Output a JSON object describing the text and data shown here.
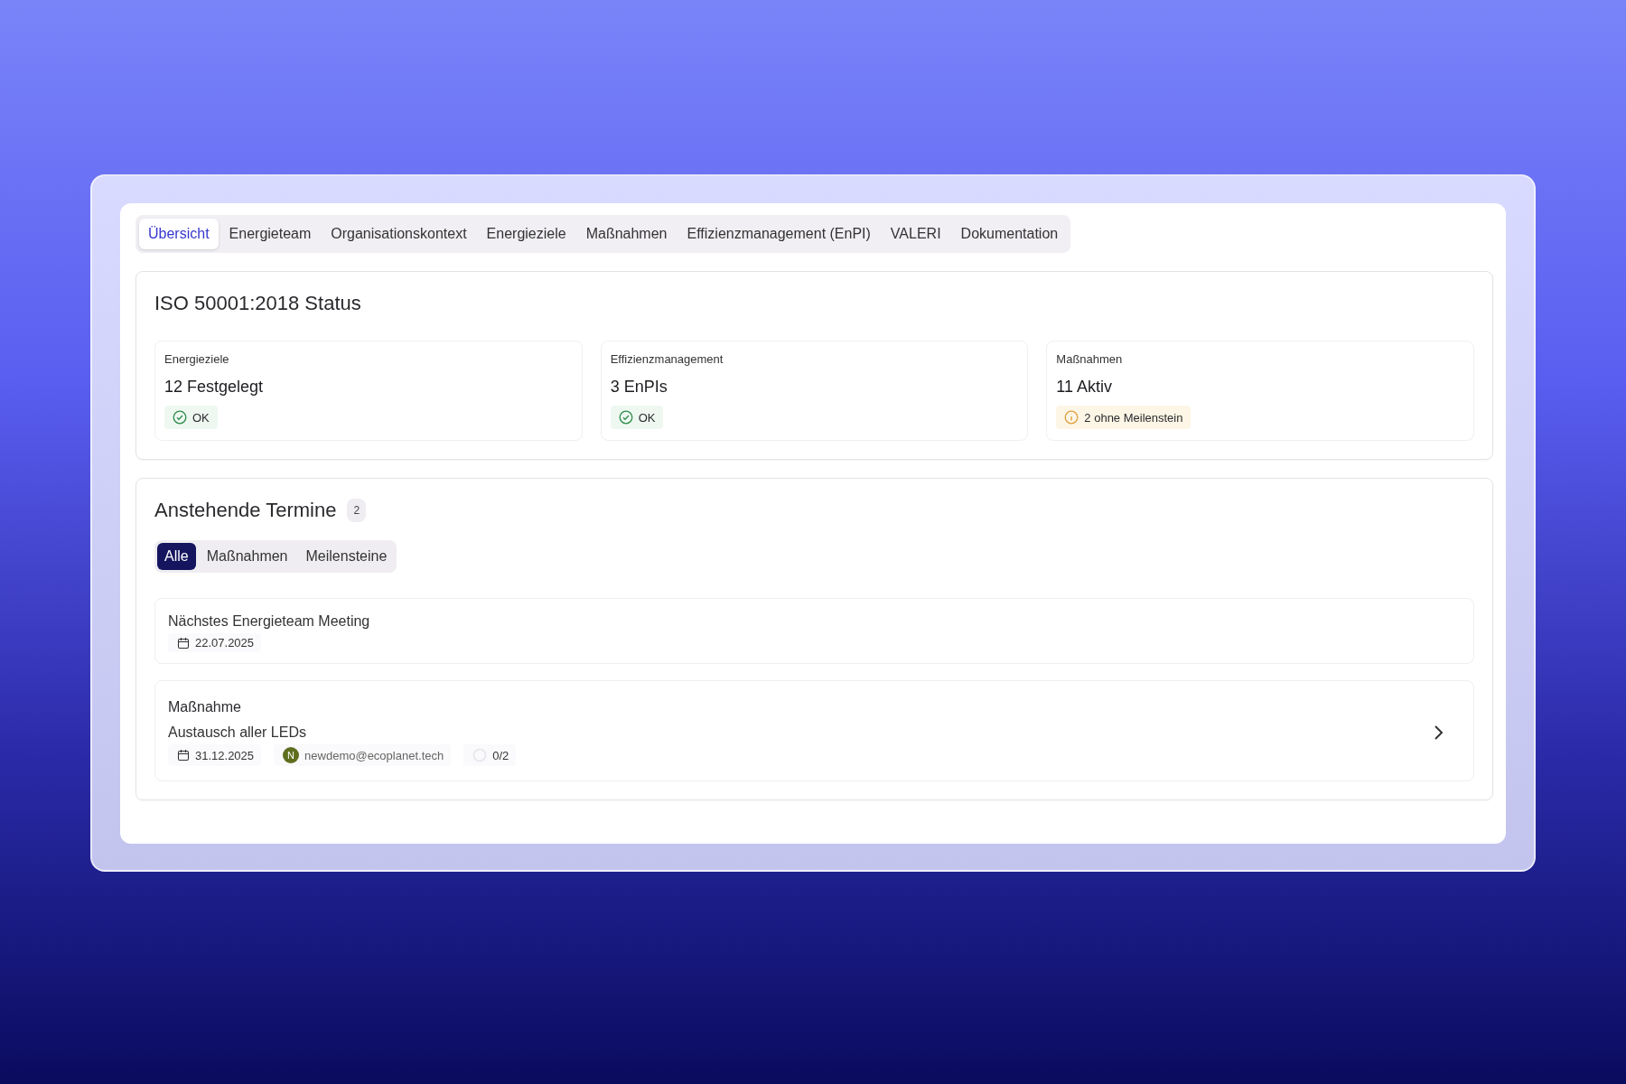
{
  "tabs": [
    {
      "label": "Übersicht",
      "selected": true
    },
    {
      "label": "Energieteam",
      "selected": false
    },
    {
      "label": "Organisationskontext",
      "selected": false
    },
    {
      "label": "Energieziele",
      "selected": false
    },
    {
      "label": "Maßnahmen",
      "selected": false
    },
    {
      "label": "Effizienzmanagement (EnPI)",
      "selected": false
    },
    {
      "label": "VALERI",
      "selected": false
    },
    {
      "label": "Dokumentation",
      "selected": false
    }
  ],
  "status": {
    "title": "ISO 50001:2018 Status",
    "cards": [
      {
        "label": "Energieziele",
        "value": "12 Festgelegt",
        "badge": {
          "kind": "ok",
          "text": "OK"
        }
      },
      {
        "label": "Effizienzmanagement",
        "value": "3 EnPIs",
        "badge": {
          "kind": "ok",
          "text": "OK"
        }
      },
      {
        "label": "Maßnahmen",
        "value": "11 Aktiv",
        "badge": {
          "kind": "warning",
          "text": "2 ohne Meilenstein"
        }
      }
    ]
  },
  "termine": {
    "title": "Anstehende Termine",
    "count": "2",
    "filters": [
      {
        "label": "Alle",
        "selected": true
      },
      {
        "label": "Maßnahmen",
        "selected": false
      },
      {
        "label": "Meilensteine",
        "selected": false
      }
    ],
    "items": [
      {
        "kind": "meeting",
        "title": "Nächstes Energieteam Meeting",
        "date": "22.07.2025"
      },
      {
        "kind": "massnahme",
        "type": "Maßnahme",
        "title": "Austausch aller LEDs",
        "date": "31.12.2025",
        "avatar": "N",
        "owner": "newdemo@ecoplanet.tech",
        "progress": "0/2"
      }
    ]
  }
}
